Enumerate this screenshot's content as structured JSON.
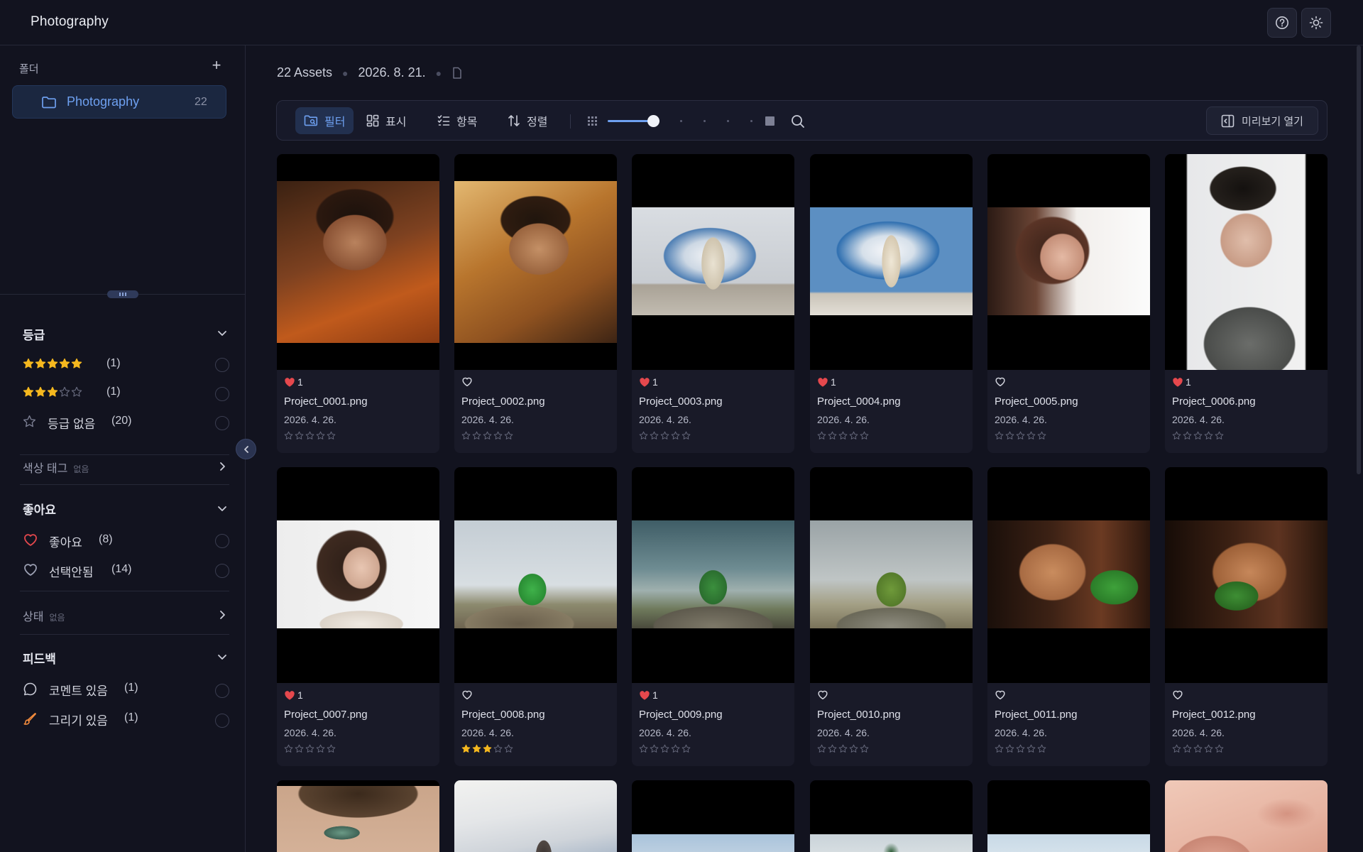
{
  "header": {
    "title": "Photography"
  },
  "sidebar": {
    "folders_label": "폴더",
    "folder": {
      "name": "Photography",
      "count": "22"
    },
    "rating": {
      "title": "등급",
      "rows": [
        {
          "stars": 5,
          "count": "(1)"
        },
        {
          "stars": 3,
          "count": "(1)"
        },
        {
          "label": "등급 없음",
          "count": "(20)"
        }
      ]
    },
    "color_tags": {
      "title": "색상 태그",
      "sub": "없음"
    },
    "likes": {
      "title": "좋아요",
      "rows": [
        {
          "label": "좋아요",
          "count": "(8)"
        },
        {
          "label": "선택안됨",
          "count": "(14)"
        }
      ]
    },
    "status": {
      "title": "상태",
      "sub": "없음"
    },
    "feedback": {
      "title": "피드백",
      "rows": [
        {
          "label": "코멘트 있음",
          "count": "(1)"
        },
        {
          "label": "그리기 있음",
          "count": "(1)"
        }
      ]
    }
  },
  "main": {
    "assets_count": "22 Assets",
    "date": "2026. 8. 21.",
    "toolbar": {
      "filter": "필터",
      "display": "표시",
      "items": "항목",
      "sort": "정렬",
      "zoom_level": 0.33,
      "preview": "미리보기 열기"
    },
    "colors": {
      "accent": "#6ea0f0",
      "like": "#e5484d",
      "star": "#f5b81f"
    },
    "cards": [
      {
        "file": "Project_0001.png",
        "date": "2026. 4. 26.",
        "liked": true,
        "likes": "1",
        "rating": 0
      },
      {
        "file": "Project_0002.png",
        "date": "2026. 4. 26.",
        "liked": false,
        "likes": "",
        "rating": 0
      },
      {
        "file": "Project_0003.png",
        "date": "2026. 4. 26.",
        "liked": true,
        "likes": "1",
        "rating": 0
      },
      {
        "file": "Project_0004.png",
        "date": "2026. 4. 26.",
        "liked": true,
        "likes": "1",
        "rating": 0
      },
      {
        "file": "Project_0005.png",
        "date": "2026. 4. 26.",
        "liked": false,
        "likes": "",
        "rating": 0
      },
      {
        "file": "Project_0006.png",
        "date": "2026. 4. 26.",
        "liked": true,
        "likes": "1",
        "rating": 0
      },
      {
        "file": "Project_0007.png",
        "date": "2026. 4. 26.",
        "liked": true,
        "likes": "1",
        "rating": 0
      },
      {
        "file": "Project_0008.png",
        "date": "2026. 4. 26.",
        "liked": false,
        "likes": "",
        "rating": 3
      },
      {
        "file": "Project_0009.png",
        "date": "2026. 4. 26.",
        "liked": true,
        "likes": "1",
        "rating": 0
      },
      {
        "file": "Project_0010.png",
        "date": "2026. 4. 26.",
        "liked": false,
        "likes": "",
        "rating": 0
      },
      {
        "file": "Project_0011.png",
        "date": "2026. 4. 26.",
        "liked": false,
        "likes": "",
        "rating": 0
      },
      {
        "file": "Project_0012.png",
        "date": "2026. 4. 26.",
        "liked": false,
        "likes": "",
        "rating": 0
      }
    ]
  }
}
